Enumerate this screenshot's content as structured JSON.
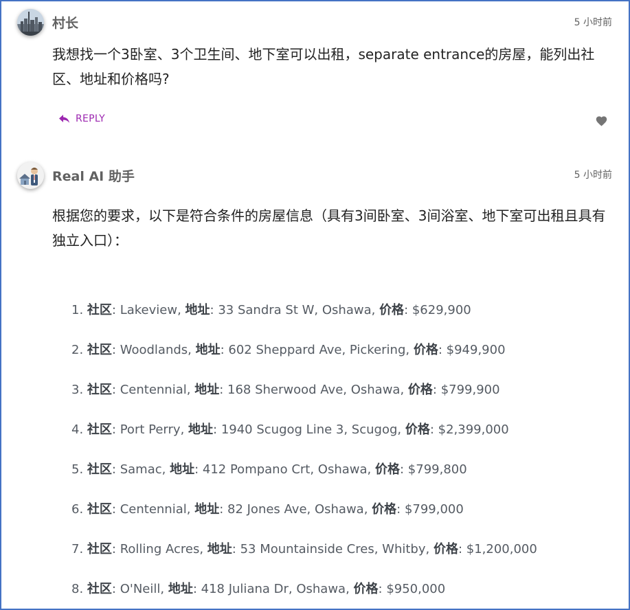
{
  "post1": {
    "author": "村长",
    "time": "5 小时前",
    "text": "我想找一个3卧室、3个卫生间、地下室可以出租，separate entrance的房屋，能列出社区、地址和价格吗?",
    "reply_label": "REPLY",
    "avatar_icon": "city-skyline-avatar",
    "like_icon": "heart-icon"
  },
  "post2": {
    "author": "Real AI 助手",
    "time": "5 小时前",
    "intro": "根据您的要求，以下是符合条件的房屋信息（具有3间卧室、3间浴室、地下室可出租且具有独立入口）：",
    "avatar_icon": "agent-with-house-avatar",
    "labels": {
      "community": "社区",
      "address": "地址",
      "price": "价格"
    },
    "listings": [
      {
        "num": "1.",
        "community": "Lakeview",
        "address": "33 Sandra St W, Oshawa",
        "price": "$629,900"
      },
      {
        "num": "2.",
        "community": "Woodlands",
        "address": "602 Sheppard Ave, Pickering",
        "price": "$949,900"
      },
      {
        "num": "3.",
        "community": "Centennial",
        "address": "168 Sherwood Ave, Oshawa",
        "price": "$799,900"
      },
      {
        "num": "4.",
        "community": "Port Perry",
        "address": "1940 Scugog Line 3, Scugog",
        "price": "$2,399,000"
      },
      {
        "num": "5.",
        "community": "Samac",
        "address": "412 Pompano Crt, Oshawa",
        "price": "$799,800"
      },
      {
        "num": "6.",
        "community": "Centennial",
        "address": "82 Jones Ave, Oshawa",
        "price": "$799,000"
      },
      {
        "num": "7.",
        "community": "Rolling Acres",
        "address": "53 Mountainside Cres, Whitby",
        "price": "$1,200,000"
      },
      {
        "num": "8.",
        "community": "O'Neill",
        "address": "418 Juliana Dr, Oshawa",
        "price": "$950,000"
      }
    ]
  },
  "colors": {
    "border": "#4472c4",
    "reply": "#9c27b0",
    "author": "#616161",
    "heart": "#757575"
  }
}
